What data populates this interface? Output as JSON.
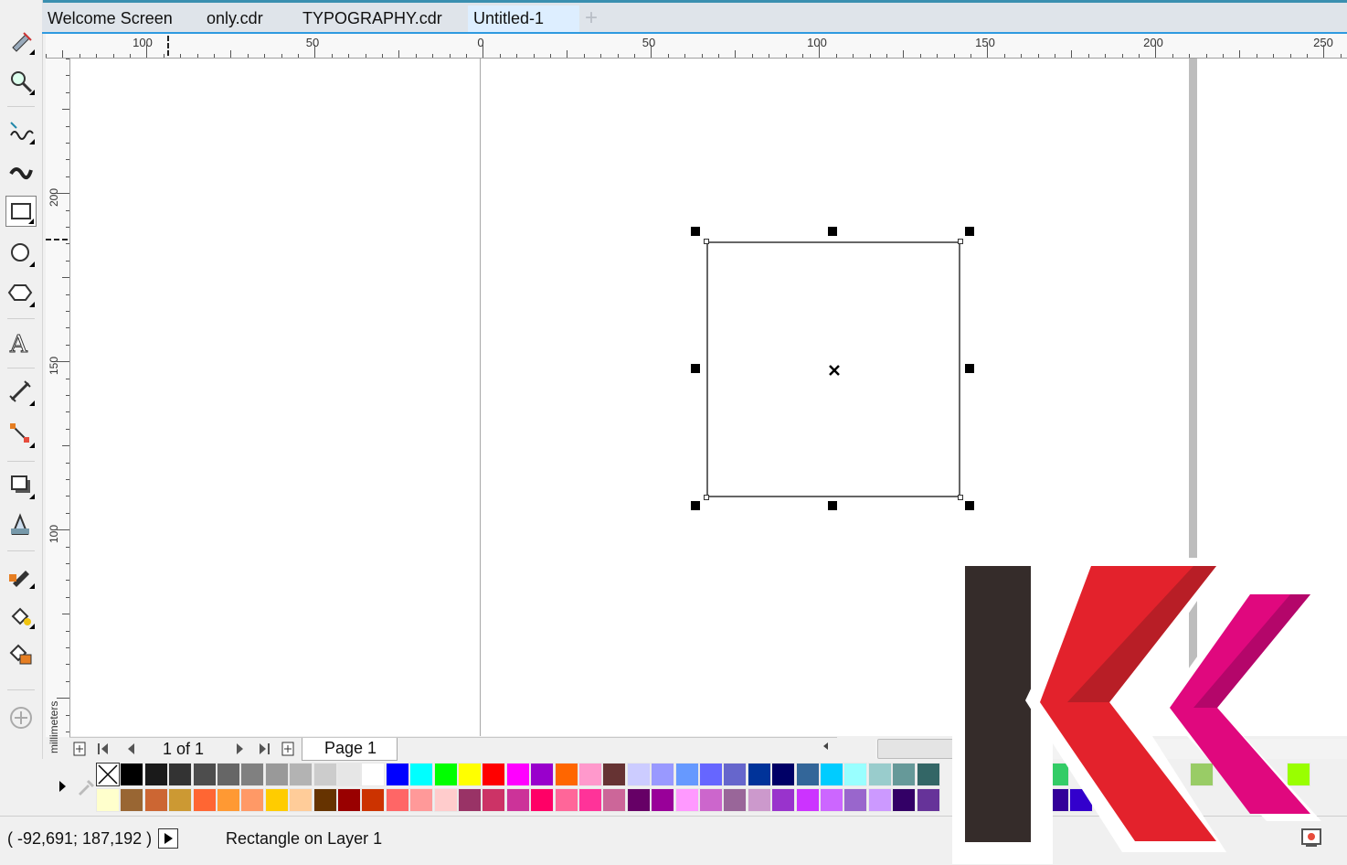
{
  "tabs": [
    {
      "label": "Welcome Screen",
      "active": false
    },
    {
      "label": "only.cdr",
      "active": false
    },
    {
      "label": "TYPOGRAPHY.cdr",
      "active": false
    },
    {
      "label": "Untitled-1",
      "active": true
    }
  ],
  "tab_add_symbol": "+",
  "toolbox": {
    "tools": [
      "pick-tool",
      "zoom-tool",
      "freehand-tool",
      "artistic-media-tool",
      "rectangle-tool",
      "ellipse-tool",
      "polygon-tool",
      "text-tool",
      "parallel-dimension-tool",
      "connector-tool",
      "drop-shadow-tool",
      "transparency-tool",
      "color-eyedropper-tool",
      "interactive-fill-tool",
      "smart-fill-tool",
      "add-tool"
    ],
    "selected": "rectangle-tool"
  },
  "rulers": {
    "horizontal_labels": [
      "100",
      "50",
      "0",
      "50",
      "100",
      "150",
      "200",
      "250"
    ],
    "vertical_labels": [
      "200",
      "150",
      "100"
    ],
    "unit": "millimeters"
  },
  "page_nav": {
    "count": "1 of 1",
    "page_tab": "Page 1"
  },
  "palette": {
    "row1": [
      "none",
      "#000000",
      "#1a1a1a",
      "#333333",
      "#4d4d4d",
      "#666666",
      "#808080",
      "#999999",
      "#b3b3b3",
      "#cccccc",
      "#e6e6e6",
      "#ffffff",
      "#0000ff",
      "#00ffff",
      "#00ff00",
      "#ffff00",
      "#ff0000",
      "#ff00ff",
      "#9900cc",
      "#ff6600",
      "#ff99cc",
      "#663333",
      "#ccccff",
      "#9999ff",
      "#6699ff",
      "#6666ff",
      "#6666cc",
      "#003399",
      "#000066",
      "#336699",
      "#00ccff",
      "#99ffff",
      "#99cccc",
      "#669999",
      "#336666"
    ],
    "row2": [
      "#ffffcc",
      "#996633",
      "#cc6633",
      "#cc9933",
      "#ff6633",
      "#ff9933",
      "#ff9966",
      "#ffcc00",
      "#ffcc99",
      "#663300",
      "#990000",
      "#cc3300",
      "#ff6666",
      "#ff9999",
      "#ffcccc",
      "#993366",
      "#cc3366",
      "#cc3399",
      "#ff0066",
      "#ff6699",
      "#ff3399",
      "#cc6699",
      "#660066",
      "#990099",
      "#ff99ff",
      "#cc66cc",
      "#996699",
      "#cc99cc",
      "#9933cc",
      "#cc33ff",
      "#cc66ff",
      "#9966cc",
      "#cc99ff",
      "#330066",
      "#663399"
    ],
    "tail_row1": [
      "#33cc66",
      "#66ff99",
      "#99ff99",
      "#99cc66",
      "#99ff33",
      "#99ff00"
    ],
    "tail_row2": [
      "#330099",
      "#3300cc"
    ]
  },
  "status": {
    "coords": "( -92,691; 187,192 )",
    "message": "Rectangle on Layer 1"
  },
  "colors": {
    "accent": "#2f9ae0",
    "logo_dark": "#352c2a",
    "logo_red": "#e3222c",
    "logo_magenta": "#e0087e"
  }
}
